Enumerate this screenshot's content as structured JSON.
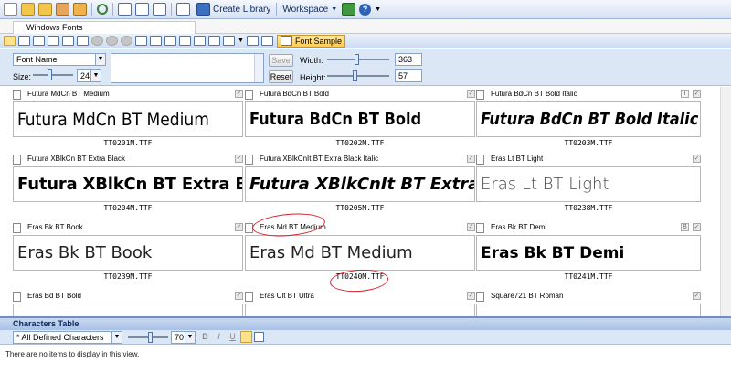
{
  "toolbar": {
    "create_library": "Create Library",
    "workspace": "Workspace"
  },
  "tab": {
    "label": "Windows Fonts"
  },
  "toolbar2": {
    "font_sample": "Font Sample"
  },
  "filters": {
    "font_name": "Font Name",
    "size_label": "Size:",
    "size_value": "24",
    "save": "Save",
    "reset": "Reset",
    "width_label": "Width:",
    "width_value": "363",
    "height_label": "Height:",
    "height_value": "57"
  },
  "fonts": [
    {
      "name": "Futura MdCn BT Medium",
      "sample": "Futura MdCn BT Medium",
      "file": "TT0201M.TTF"
    },
    {
      "name": "Futura BdCn BT Bold",
      "sample": "Futura BdCn BT Bold",
      "file": "TT0202M.TTF"
    },
    {
      "name": "Futura BdCn BT Bold Italic",
      "sample": "Futura BdCn BT Bold Italic",
      "file": "TT0203M.TTF",
      "style_badge": "I"
    },
    {
      "name": "Futura XBlkCn BT Extra Black",
      "sample": "Futura XBlkCn BT Extra Black",
      "file": "TT0204M.TTF"
    },
    {
      "name": "Futura XBlkCnIt BT Extra Black Italic",
      "sample": "Futura XBlkCnIt BT Extra Black",
      "file": "TT0205M.TTF"
    },
    {
      "name": "Eras Lt BT Light",
      "sample": "Eras Lt BT Light",
      "file": "TT0238M.TTF"
    },
    {
      "name": "Eras Bk BT Book",
      "sample": "Eras Bk BT Book",
      "file": "TT0239M.TTF"
    },
    {
      "name": "Eras Md BT Medium",
      "sample": "Eras Md BT Medium",
      "file": "TT0240M.TTF"
    },
    {
      "name": "Eras Bk BT Demi",
      "sample": "Eras Bk BT Demi",
      "file": "TT0241M.TTF",
      "style_badge": "B"
    },
    {
      "name": "Eras Bd BT Bold"
    },
    {
      "name": "Eras Ult BT Ultra"
    },
    {
      "name": "Square721 BT Roman"
    }
  ],
  "characters": {
    "title": "Characters Table",
    "filter": "* All Defined Characters",
    "zoom": "70",
    "bold": "B",
    "italic": "I",
    "underline": "U",
    "empty_message": "There are no items to display in this view."
  },
  "colors": {
    "annotation": "#d8202a",
    "accent_blue": "#9db3d8",
    "highlight": "#ffcb4d"
  }
}
